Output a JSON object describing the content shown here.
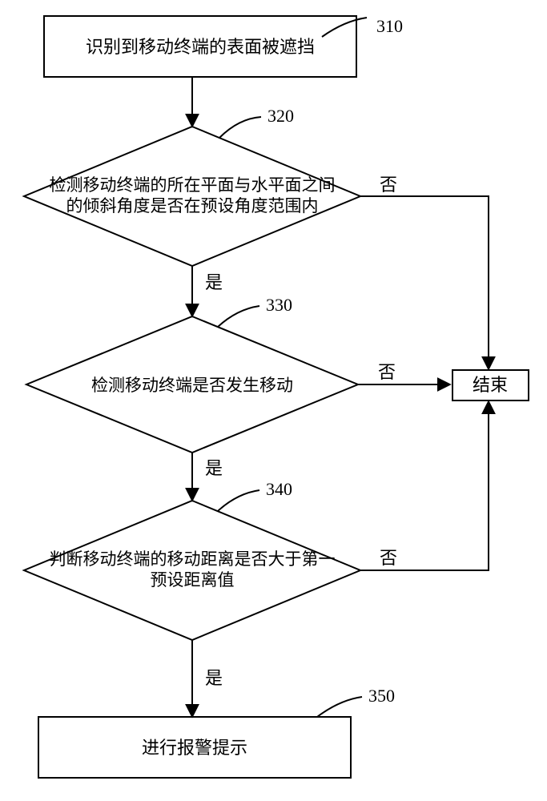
{
  "steps": {
    "s310": {
      "num": "310",
      "text": "识别到移动终端的表面被遮挡"
    },
    "s320": {
      "num": "320",
      "line1": "检测移动终端的所在平面与水平面之间",
      "line2": "的倾斜角度是否在预设角度范围内"
    },
    "s330": {
      "num": "330",
      "text": "检测移动终端是否发生移动"
    },
    "s340": {
      "num": "340",
      "line1": "判断移动终端的移动距离是否大于第一",
      "line2": "预设距离值"
    },
    "s350": {
      "num": "350",
      "text": "进行报警提示"
    },
    "end": {
      "text": "结束"
    }
  },
  "labels": {
    "yes": "是",
    "no": "否"
  }
}
